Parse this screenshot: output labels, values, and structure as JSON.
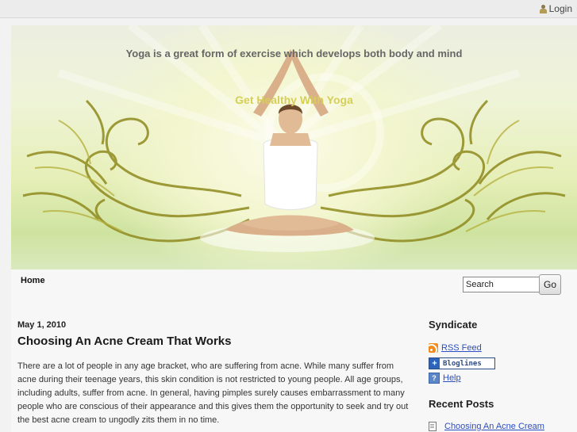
{
  "topbar": {
    "login_label": "Login"
  },
  "header": {
    "tagline": "Yoga is a great form of exercise which develops both body and mind",
    "blog_title": "Get Healthy With Yoga"
  },
  "nav": {
    "home_label": "Home"
  },
  "search": {
    "value": "Search",
    "button_label": "Go"
  },
  "post": {
    "date": "May 1, 2010",
    "title": "Choosing An Acne Cream That Works",
    "lines": [
      "There are a lot of people in any age bracket, who are suffering from acne. While many suffer from",
      "acne during their teenage years, this skin condition is not restricted to young people. All age groups,",
      "including adults, suffer from acne. In general, having pimples surely causes embarrassment to many",
      "people who are conscious of their appearance and this gives them the opportunity to seek and try out",
      "the best acne cream to ungodly zits them in no time."
    ]
  },
  "sidebar": {
    "syndicate_heading": "Syndicate",
    "rss_label": "RSS Feed",
    "bloglines_label": "Bloglines",
    "help_label": "Help",
    "recent_heading": "Recent Posts",
    "recent_items": [
      "Choosing An Acne Cream"
    ]
  },
  "colors": {
    "accent_title": "#d6cf57",
    "link": "#2b4ec2",
    "header_green": "#cfe3a0"
  },
  "icons": [
    "person-icon",
    "rss-icon",
    "bloglines-icon",
    "help-icon",
    "page-icon"
  ]
}
